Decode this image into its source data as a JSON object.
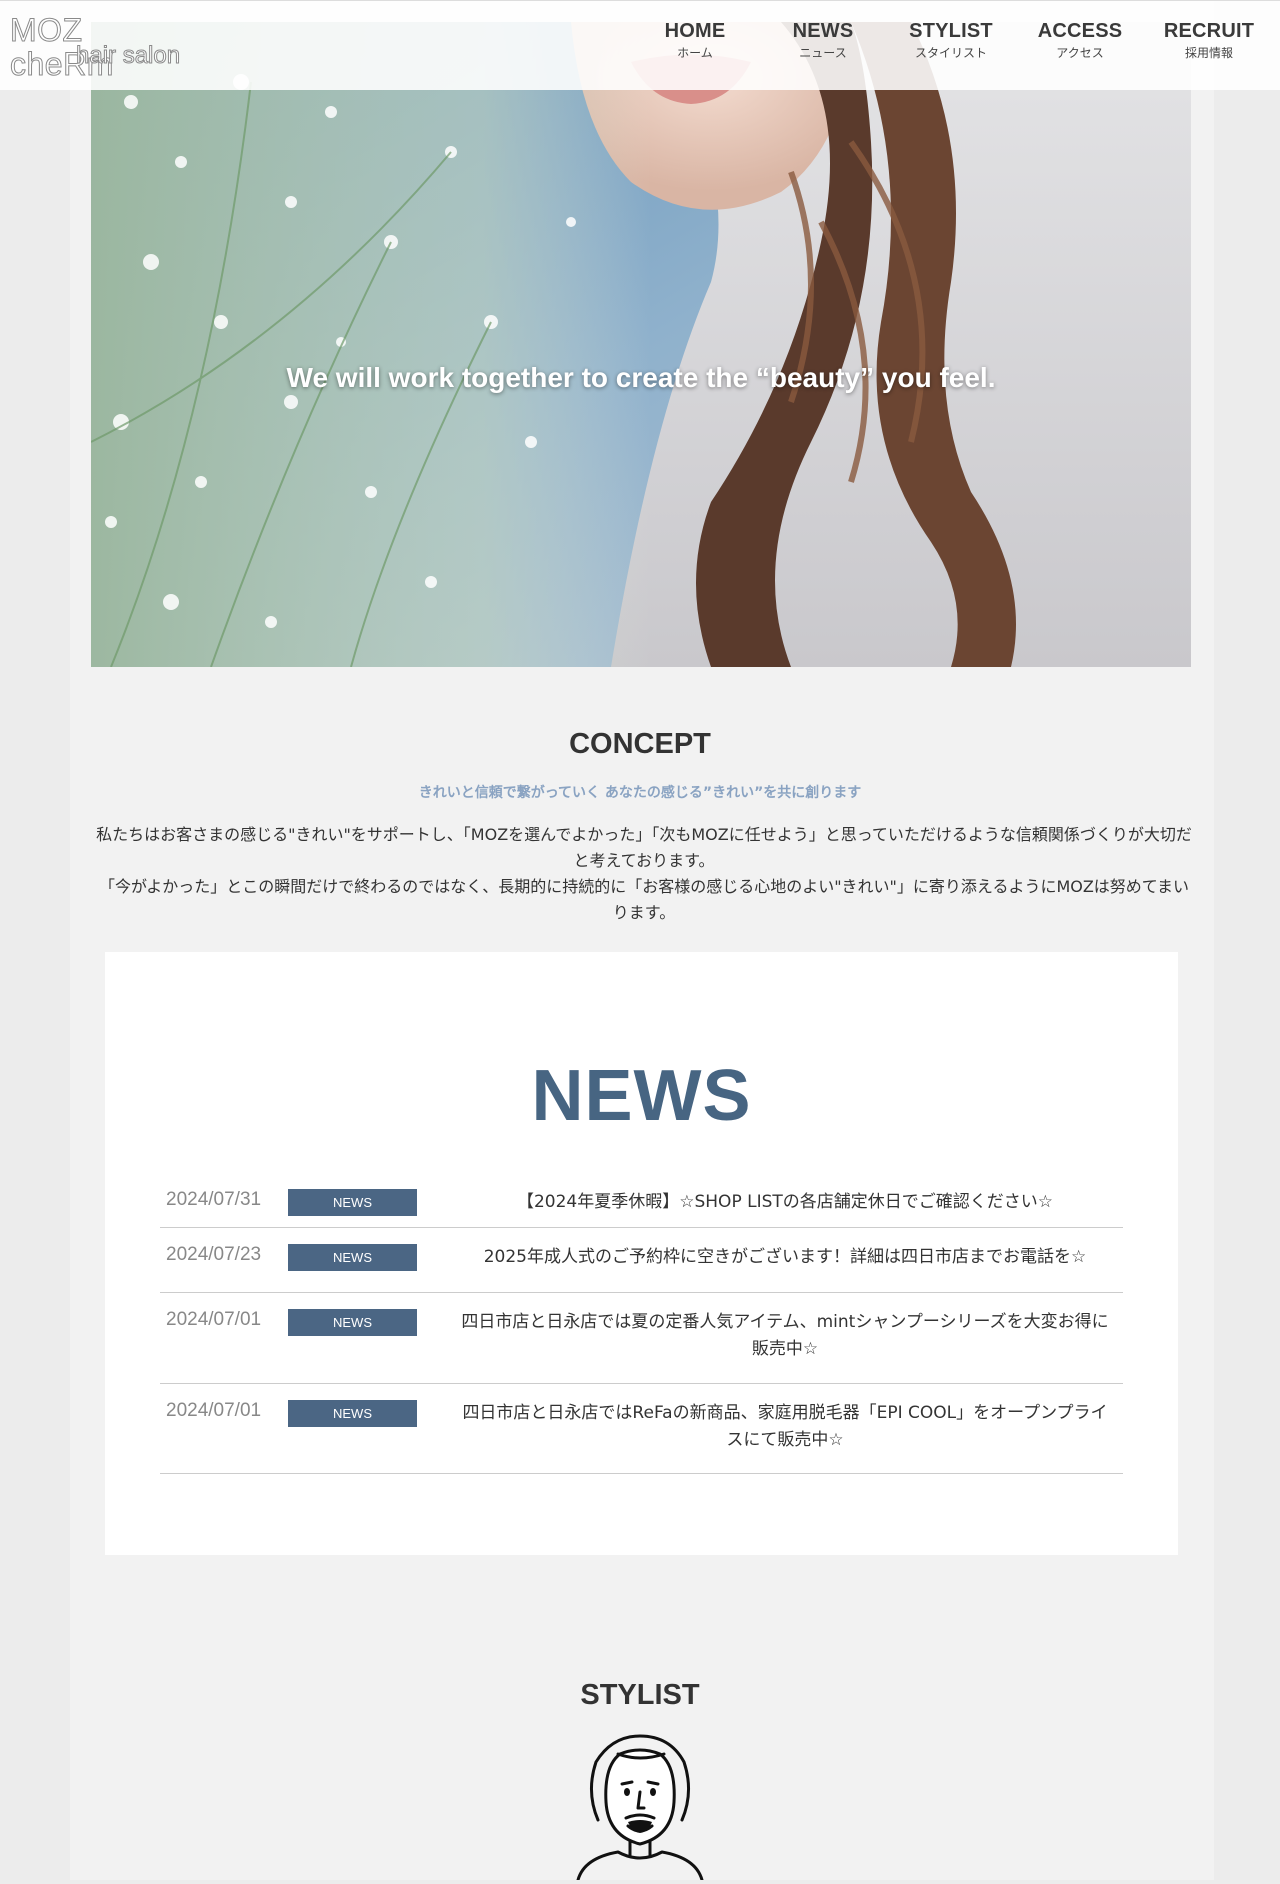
{
  "header": {
    "logo_line1": "MOZ cheRm",
    "logo_line2": "hair salon",
    "nav": [
      {
        "en": "HOME",
        "ja": "ホーム"
      },
      {
        "en": "NEWS",
        "ja": "ニュース"
      },
      {
        "en": "STYLIST",
        "ja": "スタイリスト"
      },
      {
        "en": "ACCESS",
        "ja": "アクセス"
      },
      {
        "en": "RECRUIT",
        "ja": "採用情報"
      }
    ]
  },
  "hero": {
    "tagline": "We will work together to create the “beauty” you feel."
  },
  "concept": {
    "title": "CONCEPT",
    "subtitle": "きれいと信頼で繋がっていく あなたの感じる”きれい”を共に創ります",
    "body1": "私たちはお客さまの感じる\"きれい\"をサポートし、「MOZを選んでよかった」「次もMOZに任せよう」と思っていただけるような信頼関係づくりが大切だと考えております。",
    "body2": "「今がよかった」とこの瞬間だけで終わるのではなく、長期的に持続的に「お客様の感じる心地のよい\"きれい\"」に寄り添えるようにMOZは努めてまいります。"
  },
  "news": {
    "heading": "NEWS",
    "items": [
      {
        "date": "2024/07/31",
        "badge": "NEWS",
        "title": "【2024年夏季休暇】☆SHOP LISTの各店舗定休日でご確認ください☆"
      },
      {
        "date": "2024/07/23",
        "badge": "NEWS",
        "title": "2025年成人式のご予約枠に空きがございます！詳細は四日市店までお電話を☆"
      },
      {
        "date": "2024/07/01",
        "badge": "NEWS",
        "title": "四日市店と日永店では夏の定番人気アイテム、mintシャンプーシリーズを大変お得に販売中☆"
      },
      {
        "date": "2024/07/01",
        "badge": "NEWS",
        "title": "四日市店と日永店ではReFaの新商品、家庭用脱毛器「EPI COOL」をオープンプライスにて販売中☆"
      }
    ]
  },
  "stylist": {
    "title": "STYLIST"
  }
}
